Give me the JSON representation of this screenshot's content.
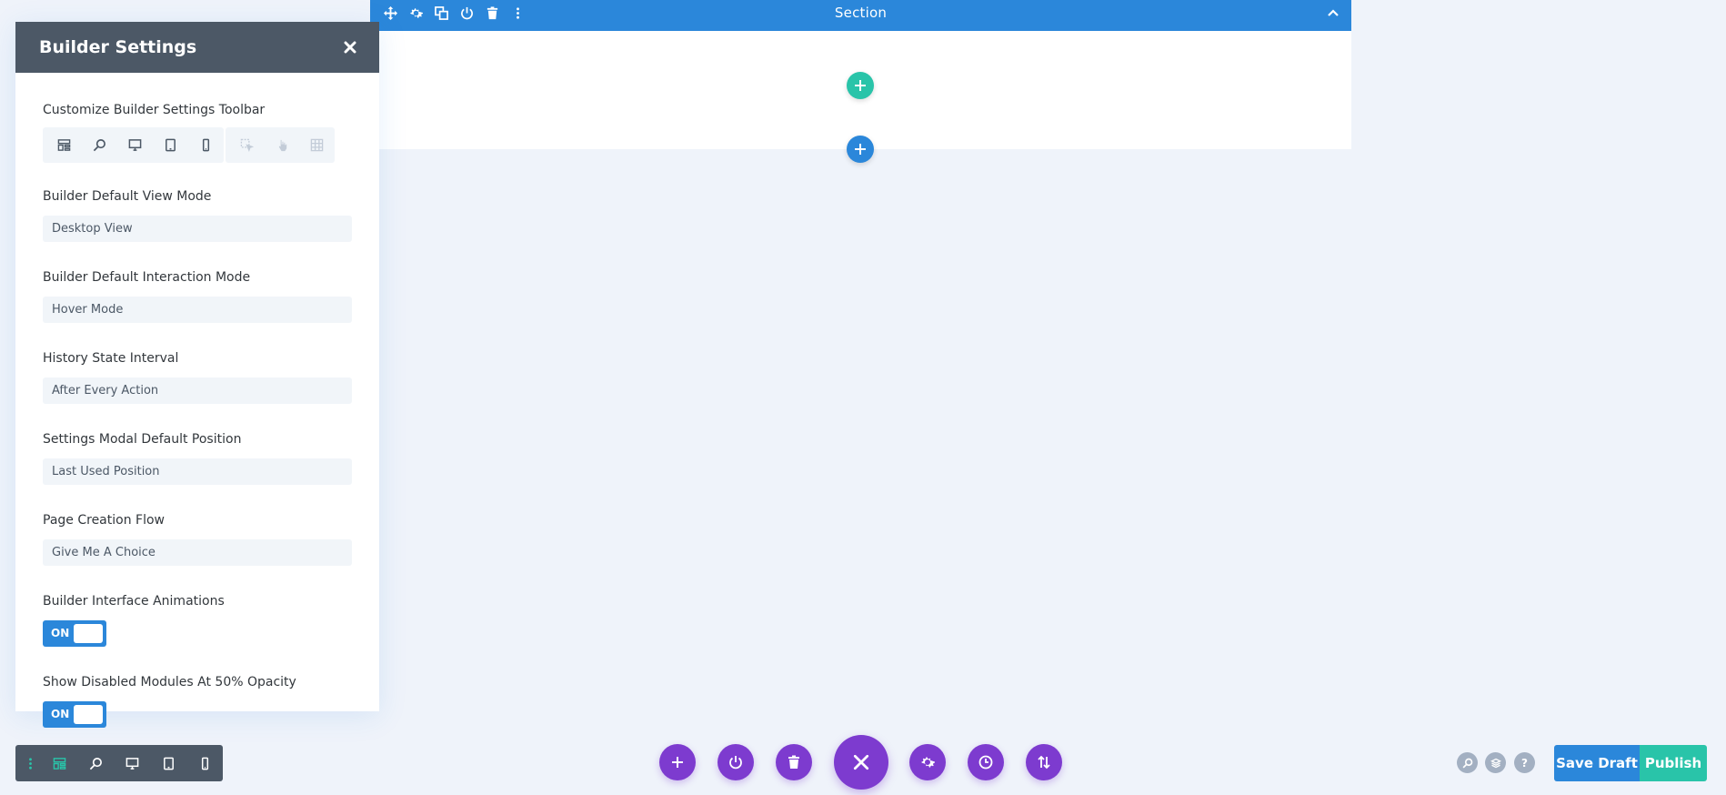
{
  "section": {
    "title": "Section",
    "tools": [
      "move-icon",
      "gear-icon",
      "duplicate-icon",
      "power-icon",
      "trash-icon",
      "more-vertical-icon"
    ]
  },
  "panel": {
    "title": "Builder Settings",
    "toolbar_label": "Customize Builder Settings Toolbar",
    "view_mode": {
      "label": "Builder Default View Mode",
      "value": "Desktop View"
    },
    "interaction_mode": {
      "label": "Builder Default Interaction Mode",
      "value": "Hover Mode"
    },
    "history_interval": {
      "label": "History State Interval",
      "value": "After Every Action"
    },
    "modal_position": {
      "label": "Settings Modal Default Position",
      "value": "Last Used Position"
    },
    "page_creation": {
      "label": "Page Creation Flow",
      "value": "Give Me A Choice"
    },
    "animations": {
      "label": "Builder Interface Animations",
      "state": "ON"
    },
    "disabled_opacity": {
      "label": "Show Disabled Modules At 50% Opacity",
      "state": "ON"
    }
  },
  "footer": {
    "save_draft": "Save Draft",
    "publish": "Publish",
    "help": "?"
  },
  "colors": {
    "blue": "#2b87da",
    "teal": "#29c4a9",
    "purple": "#7d3bcf",
    "header_gray": "#4c5866",
    "background": "#eff3fa"
  }
}
